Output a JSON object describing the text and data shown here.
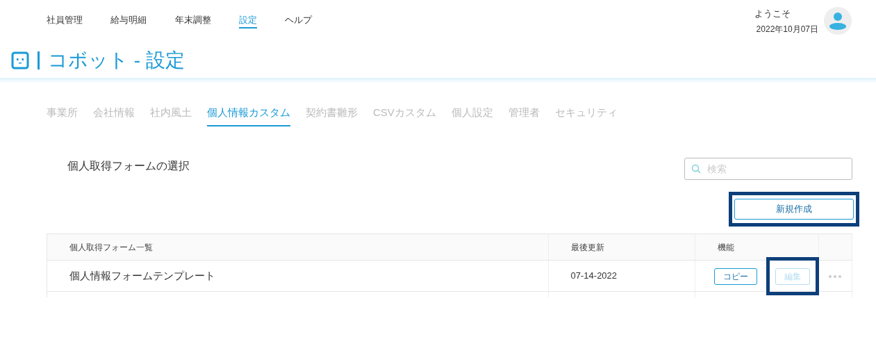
{
  "top_nav": [
    {
      "label": "社員管理",
      "selected": false
    },
    {
      "label": "給与明細",
      "selected": false
    },
    {
      "label": "年末調整",
      "selected": false
    },
    {
      "label": "設定",
      "selected": true
    },
    {
      "label": "ヘルプ",
      "selected": false
    }
  ],
  "user": {
    "greeting": "ようこそ",
    "date": "2022年10月07日"
  },
  "page_title": "コボット - 設定",
  "tabs": [
    {
      "label": "事業所",
      "selected": false
    },
    {
      "label": "会社情報",
      "selected": false
    },
    {
      "label": "社内風土",
      "selected": false
    },
    {
      "label": "個人情報カスタム",
      "selected": true
    },
    {
      "label": "契約書雛形",
      "selected": false
    },
    {
      "label": "CSVカスタム",
      "selected": false
    },
    {
      "label": "個人設定",
      "selected": false
    },
    {
      "label": "管理者",
      "selected": false
    },
    {
      "label": "セキュリティ",
      "selected": false
    }
  ],
  "section_title": "個人取得フォームの選択",
  "search": {
    "placeholder": "検索"
  },
  "new_button": {
    "label": "新規作成",
    "highlighted": true
  },
  "table": {
    "columns": [
      "個人取得フォーム一覧",
      "最後更新",
      "機能"
    ],
    "rows": [
      {
        "name": "個人情報フォームテンプレート",
        "updated": "07-14-2022",
        "actions": [
          {
            "label": "コピー",
            "disabled": false,
            "highlighted": false
          },
          {
            "label": "編集",
            "disabled": true,
            "highlighted": true
          }
        ]
      }
    ]
  }
}
